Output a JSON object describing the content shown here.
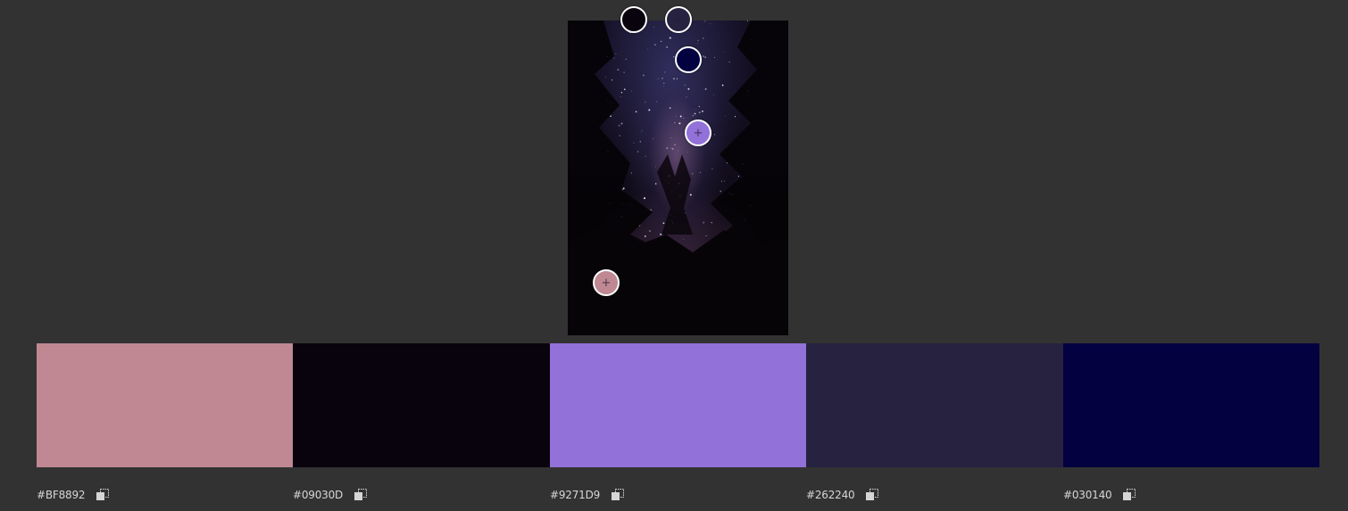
{
  "image": {
    "description_icon": "night-sky-forest-photo"
  },
  "pickers": [
    {
      "id": "picker-1",
      "color": "#09030D"
    },
    {
      "id": "picker-2",
      "color": "#262240"
    },
    {
      "id": "picker-3",
      "color": "#030140"
    },
    {
      "id": "picker-4",
      "color": "#9271D9"
    },
    {
      "id": "picker-5",
      "color": "#BF8892"
    }
  ],
  "swatches": [
    {
      "hex": "#BF8892",
      "color": "#BF8892",
      "icon": "copy-icon"
    },
    {
      "hex": "#09030D",
      "color": "#09030D",
      "icon": "copy-icon"
    },
    {
      "hex": "#9271D9",
      "color": "#9271D9",
      "icon": "copy-icon"
    },
    {
      "hex": "#262240",
      "color": "#262240",
      "icon": "copy-icon"
    },
    {
      "hex": "#030140",
      "color": "#030140",
      "icon": "copy-icon"
    }
  ],
  "colors": {
    "background": "#323232",
    "label": "#D6D6D6",
    "picker_ring": "#FFFFFF"
  }
}
